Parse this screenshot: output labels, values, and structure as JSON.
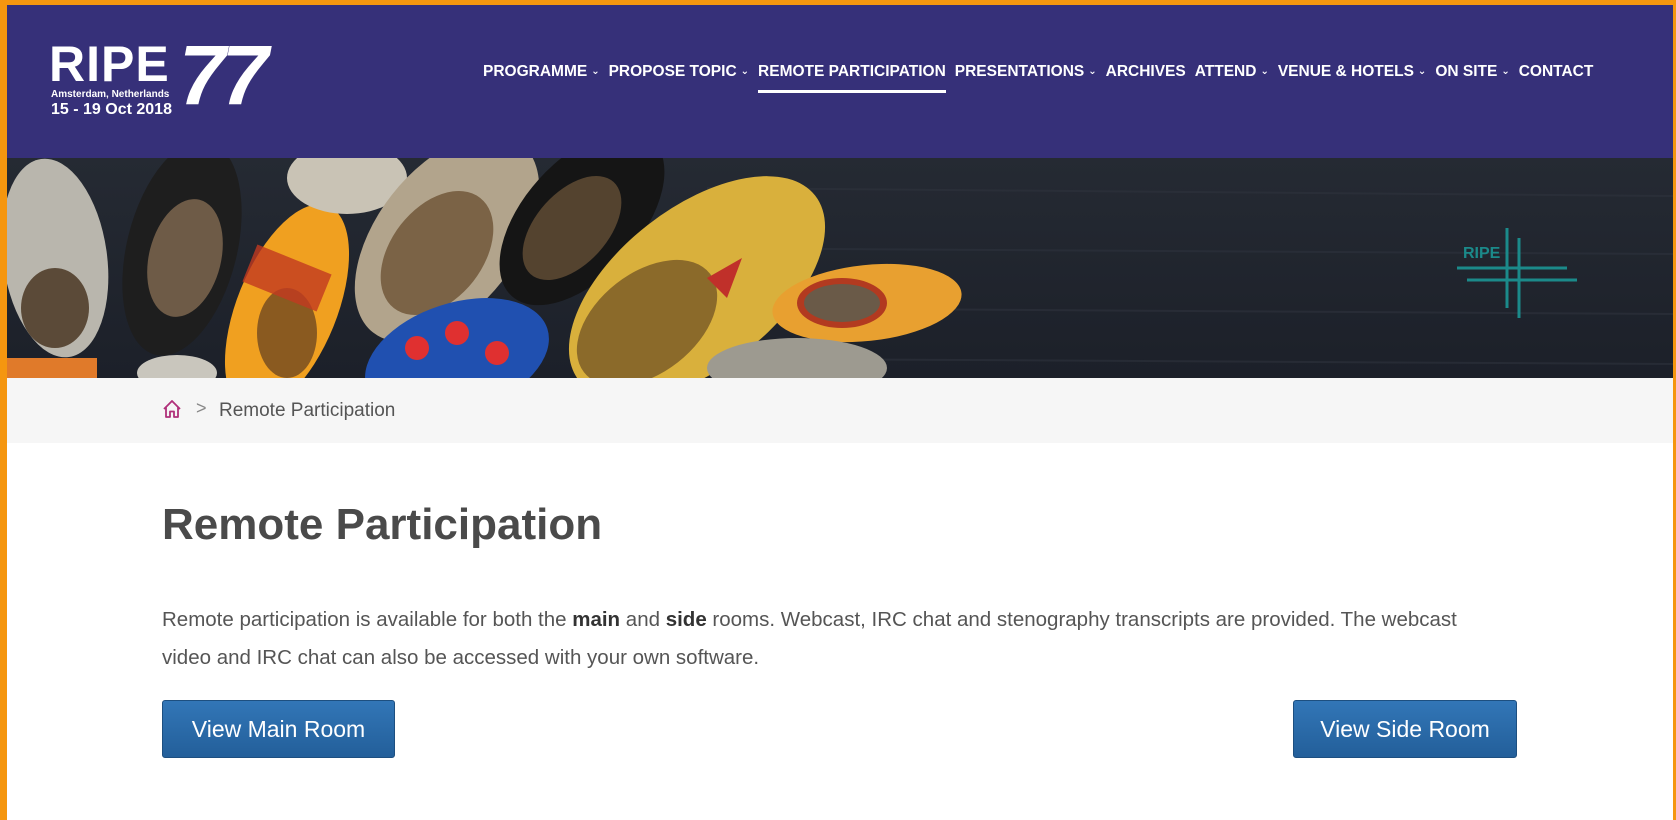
{
  "colors": {
    "header_bg": "#363079",
    "frame_border": "#f5960f",
    "button_bg": "#2a6aa8",
    "home_icon": "#b0307a"
  },
  "logo": {
    "ripe": "RIPE",
    "number": "77",
    "location": "Amsterdam, Netherlands",
    "dates": "15 - 19 Oct 2018"
  },
  "nav": {
    "items": [
      {
        "label": "PROGRAMME",
        "dropdown": true,
        "active": false
      },
      {
        "label": "PROPOSE TOPIC",
        "dropdown": true,
        "active": false
      },
      {
        "label": "REMOTE PARTICIPATION",
        "dropdown": false,
        "active": true
      },
      {
        "label": "PRESENTATIONS",
        "dropdown": true,
        "active": false
      },
      {
        "label": "ARCHIVES",
        "dropdown": false,
        "active": false
      },
      {
        "label": "ATTEND",
        "dropdown": true,
        "active": false
      },
      {
        "label": "VENUE & HOTELS",
        "dropdown": true,
        "active": false
      },
      {
        "label": "ON SITE",
        "dropdown": true,
        "active": false
      },
      {
        "label": "CONTACT",
        "dropdown": false,
        "active": false
      }
    ]
  },
  "banner": {
    "watermark": "RIPE",
    "image": "wooden-clogs-photo"
  },
  "breadcrumb": {
    "home_icon": "home-icon",
    "separator": ">",
    "current": "Remote Participation"
  },
  "main": {
    "title": "Remote Participation",
    "intro": {
      "part1": "Remote participation is available for both the ",
      "bold1": "main",
      "part2": " and ",
      "bold2": "side",
      "part3": " rooms. Webcast, IRC chat and stenography transcripts are provided. The webcast video and IRC chat can also be accessed with your own software."
    },
    "buttons": {
      "main_room": "View Main Room",
      "side_room": "View Side Room"
    }
  }
}
